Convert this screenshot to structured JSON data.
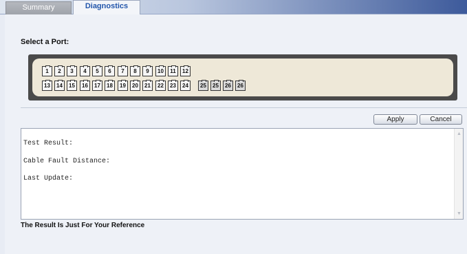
{
  "tabs": [
    {
      "label": "Summary",
      "active": false
    },
    {
      "label": "Diagnostics",
      "active": true
    }
  ],
  "select_port_label": "Select a Port:",
  "ports": {
    "row1": [
      "1",
      "2",
      "3",
      "4",
      "5",
      "6",
      "7",
      "8",
      "9",
      "10",
      "11",
      "12"
    ],
    "row2": [
      "13",
      "14",
      "15",
      "16",
      "17",
      "18",
      "19",
      "20",
      "21",
      "22",
      "23",
      "24"
    ],
    "sfp": [
      "25",
      "25",
      "26",
      "26"
    ]
  },
  "buttons": {
    "apply_label": "Apply",
    "cancel_label": "Cancel"
  },
  "results": {
    "test_result_label": "Test Result:",
    "cable_fault_distance_label": "Cable Fault Distance:",
    "last_update_label": "Last Update:"
  },
  "scrollbar": {
    "up_icon": "arrow-up-icon",
    "down_icon": "arrow-down-icon"
  },
  "note": "The Result Is Just For Your Reference",
  "colors": {
    "tab_active_text": "#2255aa",
    "panel_frame": "#4a4a4a",
    "panel_fill": "#eee8d8"
  }
}
